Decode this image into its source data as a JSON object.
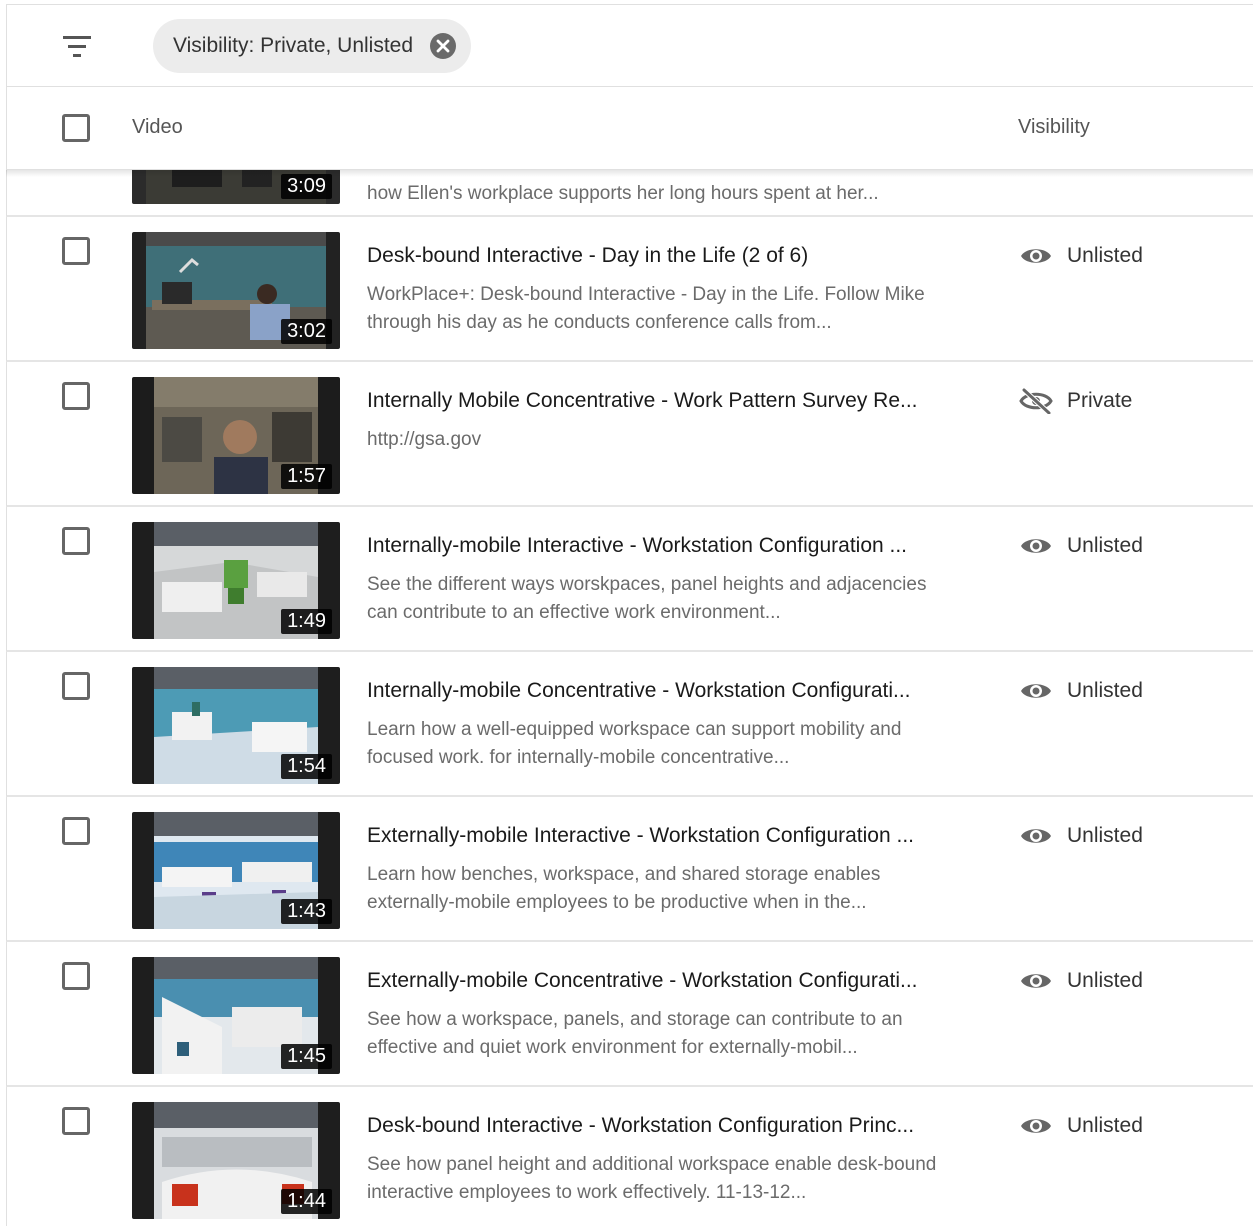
{
  "filter": {
    "icon": "filter-list-icon",
    "chip_label": "Visibility: Private, Unlisted",
    "chip_close_icon": "close-circle-icon"
  },
  "header": {
    "video_col": "Video",
    "visibility_col": "Visibility"
  },
  "rows": [
    {
      "title": "",
      "description": "how Ellen's workplace supports her long hours spent at her...",
      "duration": "3:09",
      "visibility": "",
      "visibility_icon": ""
    },
    {
      "title": "Desk-bound Interactive - Day in the Life (2 of 6)",
      "description": "WorkPlace+: Desk-bound Interactive - Day in the Life. Follow Mike through his day as he conducts conference calls from...",
      "duration": "3:02",
      "visibility": "Unlisted",
      "visibility_icon": "eye-icon"
    },
    {
      "title": "Internally Mobile Concentrative - Work Pattern Survey Re...",
      "description": "http://gsa.gov",
      "duration": "1:57",
      "visibility": "Private",
      "visibility_icon": "eye-off-icon"
    },
    {
      "title": "Internally-mobile Interactive - Workstation Configuration ...",
      "description": "See the different ways worskpaces, panel heights and adjacencies can contribute to an effective work environment...",
      "duration": "1:49",
      "visibility": "Unlisted",
      "visibility_icon": "eye-icon"
    },
    {
      "title": "Internally-mobile Concentrative - Workstation Configurati...",
      "description": "Learn how a well-equipped workspace can support mobility and focused work. for internally-mobile concentrative...",
      "duration": "1:54",
      "visibility": "Unlisted",
      "visibility_icon": "eye-icon"
    },
    {
      "title": "Externally-mobile Interactive - Workstation Configuration ...",
      "description": "Learn how benches, workspace, and shared storage enables externally-mobile employees to be productive when in the...",
      "duration": "1:43",
      "visibility": "Unlisted",
      "visibility_icon": "eye-icon"
    },
    {
      "title": "Externally-mobile Concentrative - Workstation Configurati...",
      "description": "See how a workspace, panels, and storage can contribute to an effective and quiet work environment for externally-mobil...",
      "duration": "1:45",
      "visibility": "Unlisted",
      "visibility_icon": "eye-icon"
    },
    {
      "title": "Desk-bound Interactive - Workstation Configuration Princ...",
      "description": "See how panel height and additional workspace enable desk-bound interactive employees to work effectively. 11-13-12...",
      "duration": "1:44",
      "visibility": "Unlisted",
      "visibility_icon": "eye-icon"
    }
  ]
}
